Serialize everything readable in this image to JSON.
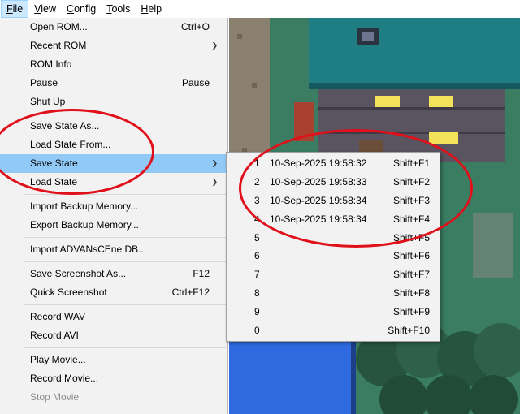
{
  "menubar": {
    "items": [
      {
        "label": "File",
        "active": true
      },
      {
        "label": "View",
        "active": false
      },
      {
        "label": "Config",
        "active": false
      },
      {
        "label": "Tools",
        "active": false
      },
      {
        "label": "Help",
        "active": false
      }
    ]
  },
  "file_menu": {
    "groups": [
      [
        {
          "label": "Open ROM...",
          "shortcut": "Ctrl+O"
        },
        {
          "label": "Recent ROM",
          "submenu": true
        },
        {
          "label": "ROM Info"
        },
        {
          "label": "Pause",
          "shortcut": "Pause"
        },
        {
          "label": "Shut Up"
        }
      ],
      [
        {
          "label": "Save State As..."
        },
        {
          "label": "Load State From..."
        },
        {
          "label": "Save State",
          "submenu": true,
          "highlight": true
        },
        {
          "label": "Load State",
          "submenu": true
        }
      ],
      [
        {
          "label": "Import Backup Memory..."
        },
        {
          "label": "Export Backup Memory..."
        }
      ],
      [
        {
          "label": "Import ADVANsCEne DB..."
        }
      ],
      [
        {
          "label": "Save Screenshot As...",
          "shortcut": "F12"
        },
        {
          "label": "Quick Screenshot",
          "shortcut": "Ctrl+F12"
        }
      ],
      [
        {
          "label": "Record WAV"
        },
        {
          "label": "Record AVI"
        }
      ],
      [
        {
          "label": "Play Movie..."
        },
        {
          "label": "Record Movie..."
        },
        {
          "label": "Stop Movie",
          "disabled": true
        }
      ]
    ]
  },
  "save_state_submenu": {
    "slots": [
      {
        "num": "1",
        "timestamp": "10-Sep-2025 19:58:32",
        "shortcut": "Shift+F1"
      },
      {
        "num": "2",
        "timestamp": "10-Sep-2025 19:58:33",
        "shortcut": "Shift+F2"
      },
      {
        "num": "3",
        "timestamp": "10-Sep-2025 19:58:34",
        "shortcut": "Shift+F3"
      },
      {
        "num": "4",
        "timestamp": "10-Sep-2025 19:58:34",
        "shortcut": "Shift+F4"
      },
      {
        "num": "5",
        "timestamp": "",
        "shortcut": "Shift+F5"
      },
      {
        "num": "6",
        "timestamp": "",
        "shortcut": "Shift+F6"
      },
      {
        "num": "7",
        "timestamp": "",
        "shortcut": "Shift+F7"
      },
      {
        "num": "8",
        "timestamp": "",
        "shortcut": "Shift+F8"
      },
      {
        "num": "9",
        "timestamp": "",
        "shortcut": "Shift+F9"
      },
      {
        "num": "0",
        "timestamp": "",
        "shortcut": "Shift+F10"
      }
    ]
  },
  "colors": {
    "menu_bg": "#f2f2f2",
    "highlight": "#91c9f7",
    "menubar_active": "#cce8ff",
    "annotation_red": "#e0101a"
  },
  "icons": {
    "submenu_arrow": "chevron-right-icon"
  }
}
